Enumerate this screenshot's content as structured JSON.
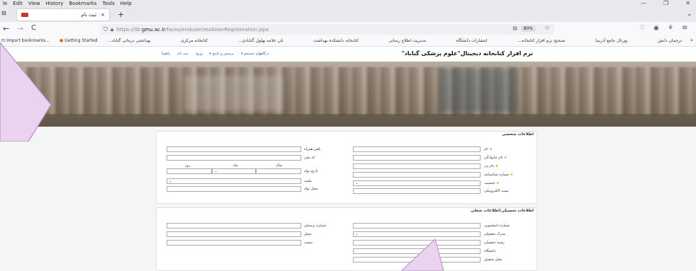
{
  "menu": {
    "items": [
      "le",
      "Edit",
      "View",
      "History",
      "Bookmarks",
      "Tools",
      "Help"
    ]
  },
  "tab": {
    "title": "ثبت نام",
    "close": "×",
    "new_tab": "+"
  },
  "nav": {
    "back": "←",
    "forward": "→",
    "reload": "C",
    "url_prefix": "https://lib.",
    "url_domain": "gmu.ac.ir",
    "url_path": "/faces/enduser/realUserRegisteration.jspx",
    "zoom": "80%"
  },
  "bookmarks": {
    "import": "Import bookmarks...",
    "getting_started": "Getting Started",
    "items": [
      "...بهداشتی درمانی گناباد",
      "کتابخانه مرکزی",
      "...تان علامه بهلول گنابادی",
      "کتابخانه دانشکده بهداشت",
      "مدیریت اطلاع رسانی",
      "انتشارات دانشگاه",
      "...تصحیح نرم افزار کتابخانه",
      "پورتال جامع آذرسا",
      "ترجمان دانش"
    ]
  },
  "site": {
    "title": "نرم افزار کتابخانه دیجیتال\"علوم پزشکی گناباد\"",
    "links": [
      "درگاههای جستجو ▾",
      "پرسش و پاسخ ▾",
      "ورود",
      "ثبت نام",
      "راهنما"
    ]
  },
  "personal": {
    "title": "اطلاعات شخصی",
    "right_labels": [
      "نام",
      "نام خانوادگی",
      "نام پدر",
      "شماره شناسنامه",
      "جنسیت",
      "پست الکترونیکی"
    ],
    "left_labels": [
      "تلفن همراه",
      "کد ملی",
      "تاریخ تولد",
      "ملیت",
      "محل تولد"
    ],
    "date_parts": [
      "سال",
      "ماه",
      "روز"
    ],
    "required_mark": "★"
  },
  "education": {
    "title": "اطلاعات تحصیلی/اطلاعات شغلی",
    "right_labels": [
      "شماره دانشجویی",
      "مدرک تحصیلی",
      "رشته تحصیلی",
      "دانشگاه",
      "محل تحصیل"
    ],
    "left_labels": [
      "شماره پرسنلی",
      "شغل",
      "سمت"
    ]
  },
  "icons": {
    "dropdown": "chevron-down-icon"
  },
  "colors": {
    "accent": "#2a5db0",
    "required": "#d4a000",
    "pointer": "#e8c8ec"
  }
}
